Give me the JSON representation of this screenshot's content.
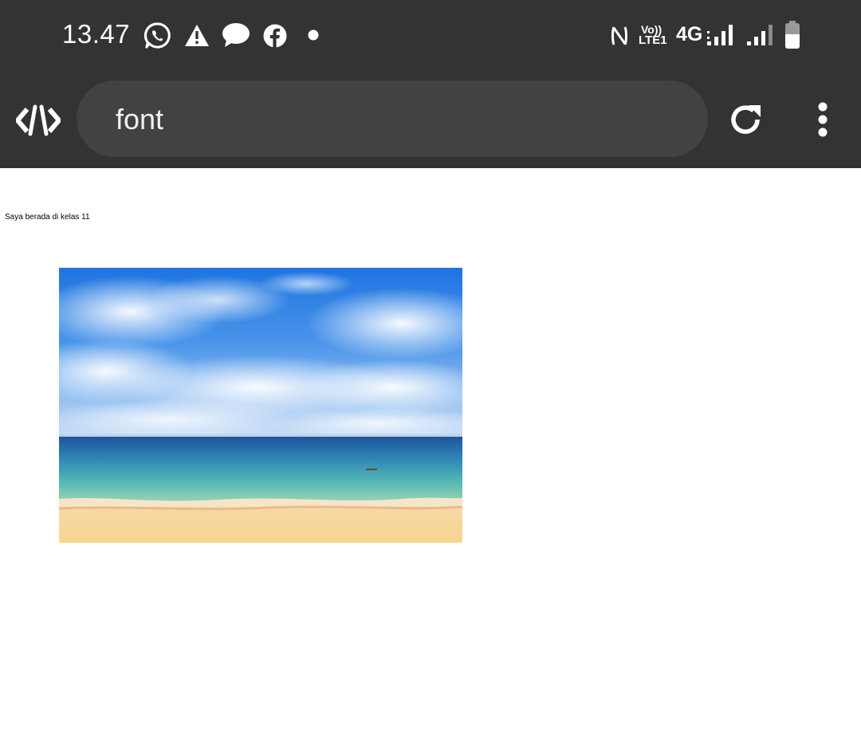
{
  "status_bar": {
    "time": "13.47",
    "notification_icons": [
      "whatsapp-icon",
      "warning-icon",
      "chat-bubble-icon",
      "facebook-icon",
      "dot-icon"
    ],
    "system_icons": [
      "nfc-icon",
      "volte-icon",
      "4g-icon",
      "signal-icon",
      "signal-icon",
      "battery-icon"
    ],
    "volte_top": "Vo))",
    "volte_bottom": "LTE1",
    "network": "4G",
    "background": "#333333"
  },
  "browser": {
    "logo_icon": "code-logo-icon",
    "address_text": "font",
    "reload_icon": "reload-icon",
    "menu_icon": "more-vert-icon",
    "toolbar_color": "#333333",
    "address_bar_color": "#424242"
  },
  "page": {
    "text": "Saya berada di kelas 11",
    "image_subject": "beach-photo"
  }
}
